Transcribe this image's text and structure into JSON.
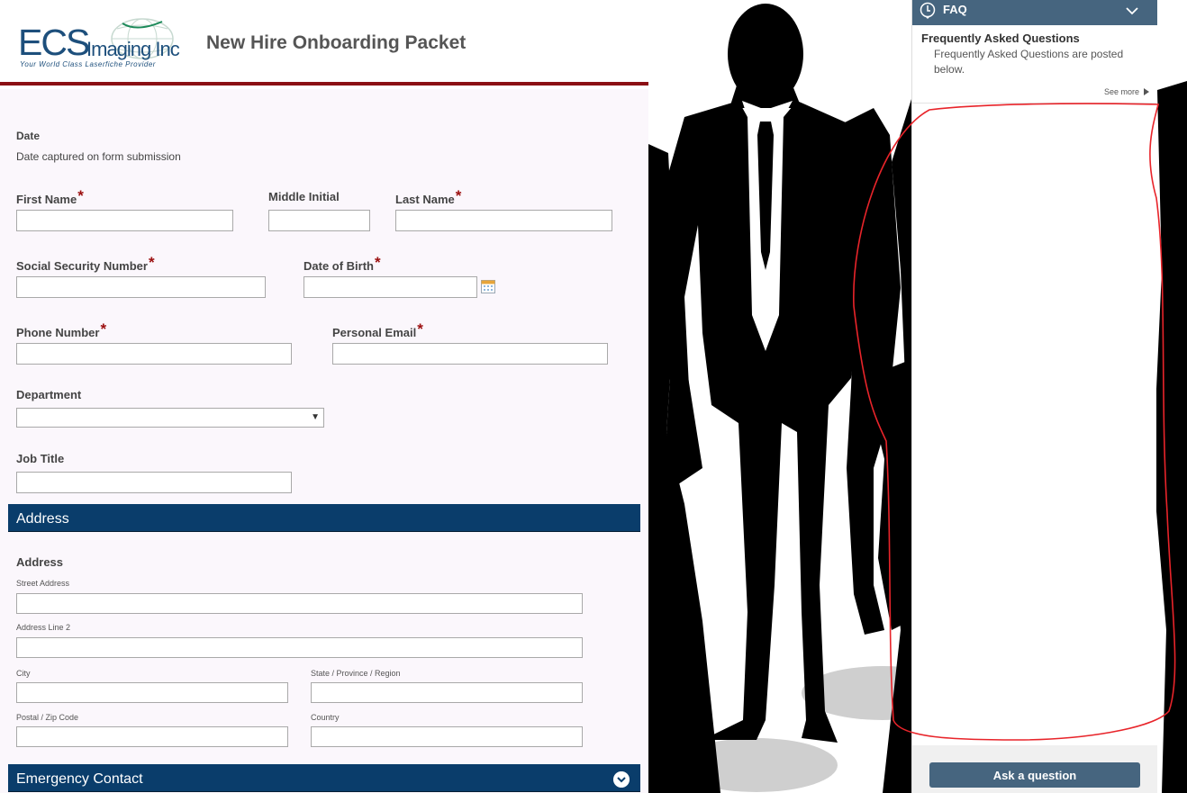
{
  "header": {
    "logo_main": "ECS",
    "logo_imaging": "Imaging Inc",
    "logo_tagline": "Your World Class Laserfiche Provider",
    "title": "New Hire Onboarding Packet"
  },
  "form": {
    "date_label": "Date",
    "date_note": "Date captured on form submission",
    "required_marker": "*",
    "first_name_label": "First Name",
    "middle_initial_label": "Middle Initial",
    "last_name_label": "Last Name",
    "ssn_label": "Social Security Number",
    "dob_label": "Date of Birth",
    "phone_label": "Phone Number",
    "email_label": "Personal Email",
    "department_label": "Department",
    "department_value": "",
    "job_title_label": "Job Title",
    "address_section": "Address",
    "address_label": "Address",
    "street_label": "Street Address",
    "line2_label": "Address Line 2",
    "city_label": "City",
    "state_label": "State / Province / Region",
    "zip_label": "Postal / Zip Code",
    "country_label": "Country",
    "emergency_section": "Emergency Contact"
  },
  "faq": {
    "header_title": "FAQ",
    "question_title": "Frequently Asked Questions",
    "question_body": "Frequently Asked Questions are posted below.",
    "see_more": "See more",
    "ask_button": "Ask a question"
  },
  "colors": {
    "brand_blue": "#1d4f7c",
    "section_bar": "#0a3d6b",
    "header_rule": "#8b0f14",
    "faq_header": "#46657f",
    "annotation": "#e8242a"
  }
}
